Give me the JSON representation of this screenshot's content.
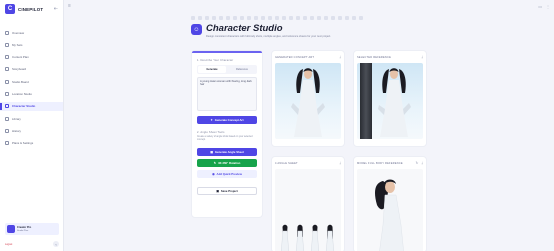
{
  "brand": {
    "name": "CINEPILOT",
    "logo": "C"
  },
  "nav": [
    {
      "label": "Overview",
      "active": false
    },
    {
      "label": "My Sets",
      "active": false
    },
    {
      "label": "Content Plan",
      "active": false
    },
    {
      "label": "Storyboard",
      "active": false
    },
    {
      "label": "Studio Board",
      "active": false
    },
    {
      "label": "Location Studio",
      "active": false
    },
    {
      "label": "Character Studio",
      "active": true
    },
    {
      "label": "Library",
      "active": false
    },
    {
      "label": "History",
      "active": false
    },
    {
      "label": "Plans & Settings",
      "active": false
    }
  ],
  "user": {
    "name": "Creator Pro",
    "plan": "Studio Plan",
    "logout": "Logout"
  },
  "header": {
    "title": "Character Studio",
    "subtitle": "Design consistent characters with full-body shots, multiple angles, and reference sheets for your next project."
  },
  "panel": {
    "section1": "1. Describe Your Character",
    "tabs": [
      "Generate",
      "Reference"
    ],
    "prompt": "A young Asian woman with flowing, long dark hair",
    "generate_concept": "Generate Concept Art",
    "section2": "2. Angle Sheet Tools",
    "help": "Create a variety of angle shots based on your selected concept.",
    "generate_angle": "Generate Angle Sheet",
    "hd_360": "4K 360° Rotation",
    "quick_preview": "Add Quick Preview",
    "save_project": "Save Project"
  },
  "cards": [
    {
      "title": "GENERATED CONCEPT ART"
    },
    {
      "title": "SELECTED REFERENCE"
    },
    {
      "title": "4 ANGLE SHEET"
    },
    {
      "title": "MODEL FULL BODY REFERENCE"
    }
  ],
  "colors": {
    "accent": "#4f46e5",
    "green": "#16a34a",
    "danger": "#d23a4a"
  }
}
